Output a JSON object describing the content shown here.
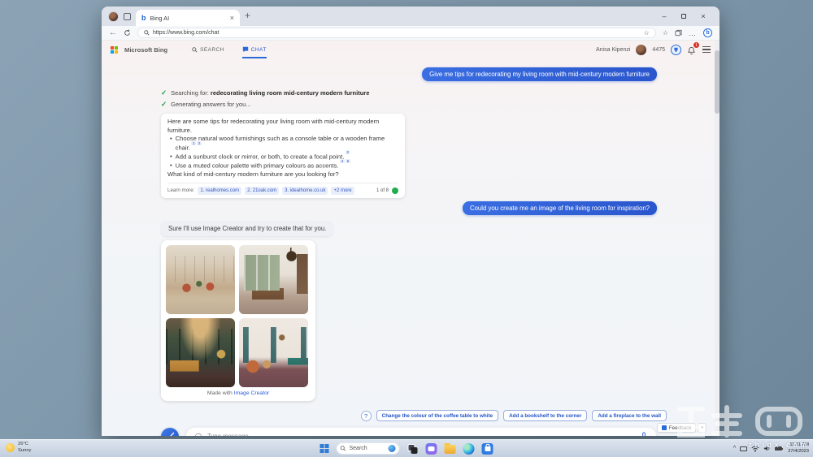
{
  "glyphs": {
    "close_x": "×",
    "minimize": "–",
    "plus": "+",
    "back": "←",
    "dots": "…",
    "star": "☆",
    "check": "✓",
    "bullet": "•",
    "bing_b": "b",
    "help": "?",
    "caret_down": "▾",
    "chevron_up": "^"
  },
  "browser": {
    "tab_title": "Bing AI",
    "url": "https://www.bing.com/chat"
  },
  "bing_header": {
    "brand": "Microsoft Bing",
    "nav_search": "SEARCH",
    "nav_chat": "CHAT",
    "user_name": "Anisa Kipenzi",
    "points": "4475",
    "notification_count": "1"
  },
  "chat": {
    "user_message_1": "Give me tips for redecorating my living room with mid-century modern furniture",
    "status_searching_label": "Searching for:",
    "status_searching_query": "redecorating living room mid-century modern furniture",
    "status_generating": "Generating answers for you...",
    "answer": {
      "intro": "Here are some tips for redecorating your living room with mid-century modern furniture.",
      "bullets": [
        {
          "text": "Choose natural wood furnishings such as a console table or a wooden frame chair.",
          "sups": [
            "1",
            "2"
          ]
        },
        {
          "text": "Add a sunburst clock or mirror, or both, to create a focal point.",
          "sups": [
            "3"
          ]
        },
        {
          "text": "Use a muted colour palette with primary colours as accents.",
          "sups": [
            "4",
            "5"
          ]
        }
      ],
      "question": "What kind of mid-century modern furniture are you looking for?",
      "learn_more_label": "Learn more:",
      "citations": [
        "1. realhomes.com",
        "2. 21oak.com",
        "3. idealhome.co.uk",
        "+2 more"
      ],
      "page_indicator": "1 of 8"
    },
    "user_message_2": "Could you create me an image of the living room for inspiration?",
    "bot_message_2": "Sure I'll use Image Creator and try to create that for you.",
    "image_card": {
      "images": [
        "generated living room, warm beige with orange chairs",
        "generated living room, large window with greenery and brown sofa",
        "generated living room, dark green walls with mustard sofa",
        "generated living room, teal curtains and daybed"
      ],
      "caption_prefix": "Made with ",
      "caption_link": "Image Creator"
    },
    "suggestions": [
      "Change the colour of the coffee table to white",
      "Add a bookshelf to the corner",
      "Add a fireplace to the wall"
    ],
    "input_placeholder": "Type message",
    "feedback_label": "Feedback"
  },
  "taskbar": {
    "weather_temp": "26°C",
    "weather_cond": "Sunny",
    "search_label": "Search",
    "time": "11:11 AM",
    "date": "27/4/2023"
  },
  "watermark": {
    "text": "zhidx.com"
  },
  "colors": {
    "accent_blue": "#2a5bd7",
    "bubble_blue": "#2e61d6",
    "green_check": "#179a48",
    "green_dot": "#21ad4c",
    "citation_bg": "#e9eefb",
    "badge_red": "#d93025",
    "ms_red": "#f25022",
    "ms_green": "#7fba00",
    "ms_blue": "#00a4ef",
    "ms_yellow": "#ffb900"
  }
}
